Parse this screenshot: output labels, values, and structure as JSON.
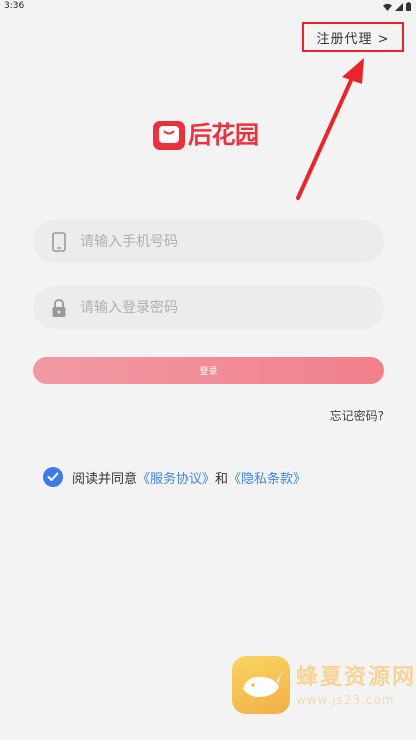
{
  "status_bar": {
    "time": "3:36"
  },
  "header": {
    "register_agent_label": "注册代理 >"
  },
  "brand": {
    "name": "后花园",
    "color": "#e8333f"
  },
  "form": {
    "phone_placeholder": "请输入手机号码",
    "phone_value": "",
    "password_placeholder": "请输入登录密码",
    "password_value": "",
    "login_label": "登录",
    "forgot_label": "忘记密码?"
  },
  "agreement": {
    "checked": true,
    "prefix": "阅读并同意",
    "service_link": "《服务协议》",
    "conjunction": "和",
    "privacy_link": "《隐私条款》"
  },
  "watermark": {
    "name": "蜂夏资源网",
    "url": "www.js23.com"
  },
  "colors": {
    "highlight_red": "#e8262a",
    "accent_blue": "#3b7be3",
    "button_pink": "#f37f8c",
    "background": "#f3f3f3"
  }
}
